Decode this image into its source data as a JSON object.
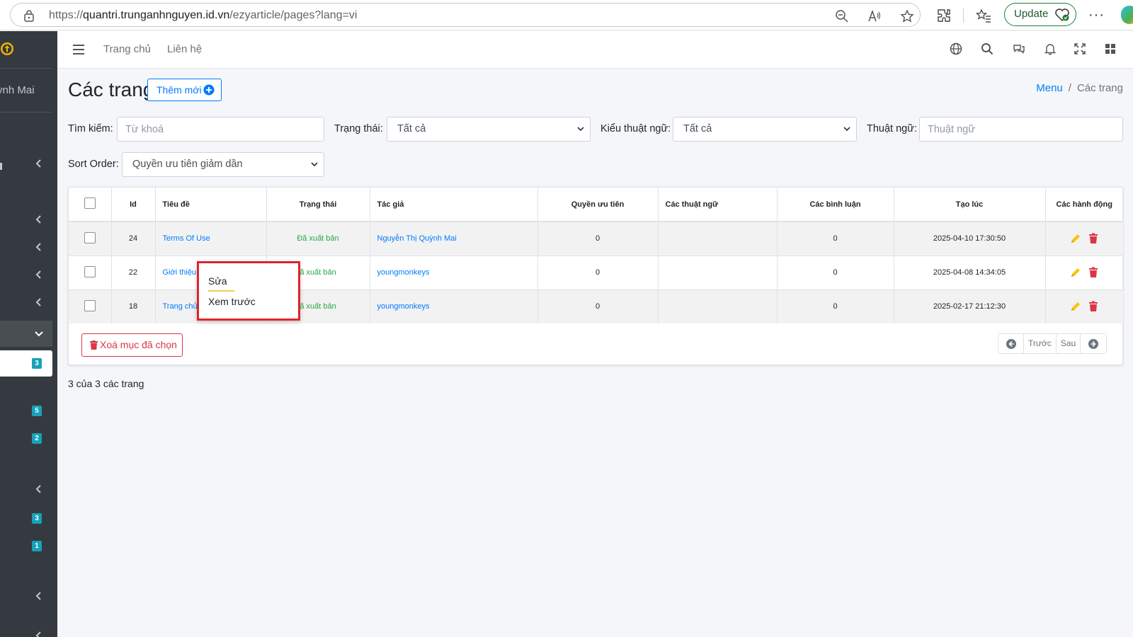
{
  "browser": {
    "url_prefix": "https://",
    "url_host": "quantri.trunganhnguyen.id.vn",
    "url_path": "/ezyarticle/pages?lang=vi",
    "update_label": "Update",
    "more_label": "···"
  },
  "sidebar": {
    "user_name": "ỳnh Mai",
    "badges": [
      "3",
      "5",
      "2",
      "3",
      "1"
    ]
  },
  "topnav": {
    "home": "Trang chủ",
    "contact": "Liên hệ"
  },
  "page": {
    "title": "Các trang",
    "add_label": "Thêm mới",
    "breadcrumb_menu": "Menu",
    "breadcrumb_sep": "/",
    "breadcrumb_current": "Các trang"
  },
  "filters": {
    "search_label": "Tìm kiếm:",
    "search_placeholder": "Từ khoá",
    "status_label": "Trạng thái:",
    "status_value": "Tất cả",
    "term_type_label": "Kiểu thuật ngữ:",
    "term_type_value": "Tất cả",
    "term_label": "Thuật ngữ:",
    "term_placeholder": "Thuật ngữ",
    "sort_label": "Sort Order:",
    "sort_value": "Quyền ưu tiên giảm dần"
  },
  "table": {
    "headers": [
      "Id",
      "Tiêu đề",
      "Trạng thái",
      "Tác giả",
      "Quyền ưu tiên",
      "Các thuật ngữ",
      "Các bình luận",
      "Tạo lúc",
      "Các hành động"
    ],
    "rows": [
      {
        "id": "24",
        "title": "Terms Of Use",
        "status": "Đã xuất bản",
        "author": "Nguyễn Thị Quỳnh Mai",
        "priority": "0",
        "terms": "",
        "comments": "0",
        "created": "2025-04-10 17:30:50"
      },
      {
        "id": "22",
        "title": "Giới thiệu",
        "status": "ã xuất bản",
        "author": "youngmonkeys",
        "priority": "0",
        "terms": "",
        "comments": "0",
        "created": "2025-04-08 14:34:05"
      },
      {
        "id": "18",
        "title": "Trang chủ",
        "status": "ã xuất bản",
        "author": "youngmonkeys",
        "priority": "0",
        "terms": "",
        "comments": "0",
        "created": "2025-02-17 21:12:30"
      }
    ],
    "delete_selected": "Xoá mục đã chọn",
    "prev": "Trước",
    "next": "Sau"
  },
  "footer": {
    "count": "3 của 3 các trang"
  },
  "context_menu": {
    "edit": "Sửa",
    "preview": "Xem trước"
  },
  "colors": {
    "primary": "#007bff",
    "success": "#28a745",
    "danger": "#dc3545",
    "warning": "#ffc107",
    "sidebar": "#343a40",
    "badge": "#17a2b8",
    "highlight": "#e0242c"
  }
}
